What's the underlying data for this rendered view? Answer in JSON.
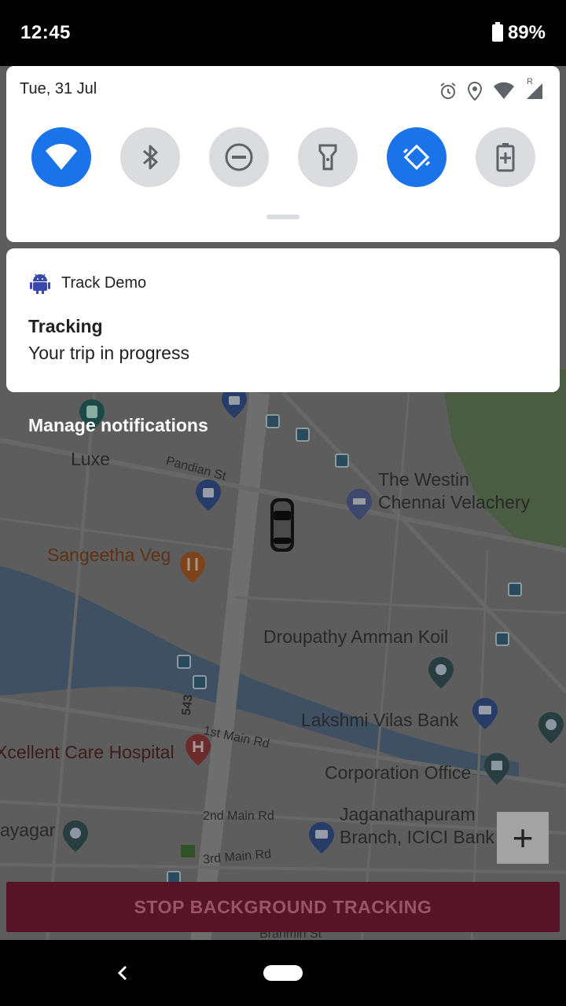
{
  "status_bar": {
    "time": "12:45",
    "battery": "89%"
  },
  "quick_settings": {
    "date": "Tue, 31 Jul",
    "network_indicator": "R",
    "tiles": [
      {
        "name": "wifi",
        "active": true
      },
      {
        "name": "bluetooth",
        "active": false
      },
      {
        "name": "do-not-disturb",
        "active": false
      },
      {
        "name": "flashlight",
        "active": false
      },
      {
        "name": "auto-rotate",
        "active": true
      },
      {
        "name": "battery-saver",
        "active": false
      }
    ]
  },
  "notification": {
    "app_name": "Track Demo",
    "title": "Tracking",
    "text": "Your trip in progress"
  },
  "manage_notifications": "Manage notifications",
  "map": {
    "labels": {
      "luxe": "Luxe",
      "pandian": "Pandian St",
      "westin": "The Westin",
      "westin2": "Chennai Velachery",
      "sangeetha": "Sangeetha Veg",
      "droupathy": "Droupathy Amman Koil",
      "lakshmi": "Lakshmi Vilas Bank",
      "road543": "543",
      "mainrd1": "1st Main Rd",
      "hospital": "Xcellent Care Hospital",
      "corp": "Corporation Office",
      "jag1": "Jaganathapuram",
      "jag2": "Branch, ICICI Bank",
      "ayagar": "ayagar",
      "mainrd2": "2nd Main Rd",
      "mainrd3": "3rd Main Rd",
      "brahmin": "Brahmin St"
    }
  },
  "controls": {
    "zoom_in": "+",
    "stop_button": "STOP BACKGROUND TRACKING"
  },
  "colors": {
    "accent": "#1a73e8",
    "stop_button": "#571429",
    "notification_icon": "#3949ab"
  }
}
